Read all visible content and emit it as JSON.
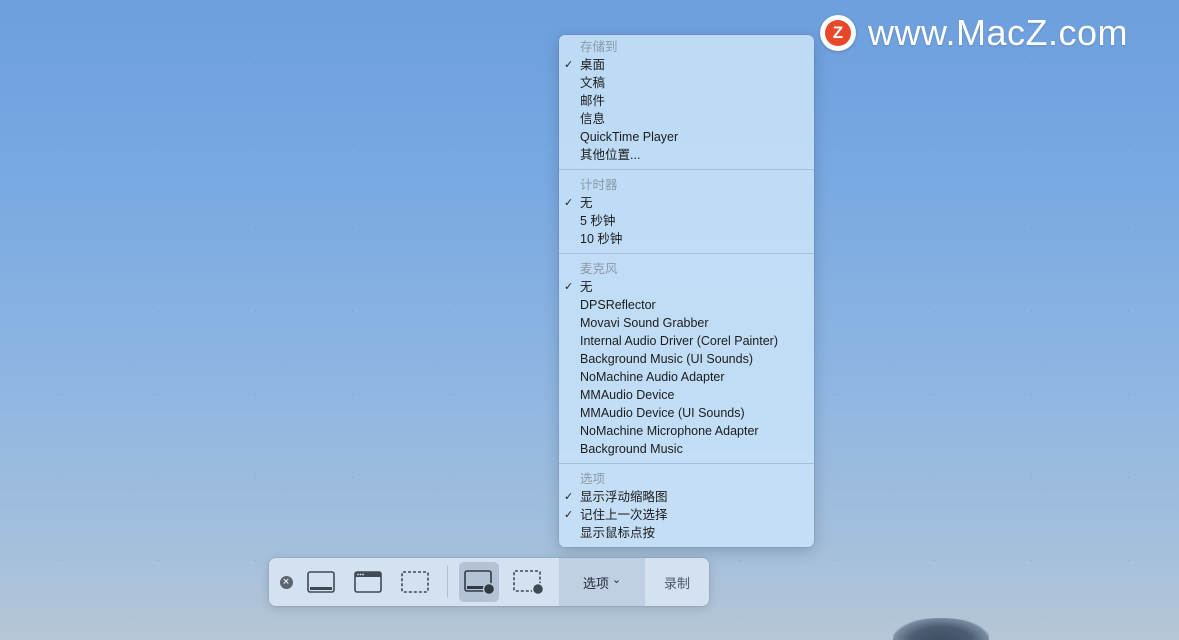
{
  "watermark": {
    "logo_letter": "Z",
    "text": "www.MacZ.com"
  },
  "menu": {
    "sections": [
      {
        "header": "存储到",
        "items": [
          {
            "label": "桌面",
            "checked": true
          },
          {
            "label": "文稿",
            "checked": false
          },
          {
            "label": "邮件",
            "checked": false
          },
          {
            "label": "信息",
            "checked": false
          },
          {
            "label": "QuickTime Player",
            "checked": false
          },
          {
            "label": "其他位置...",
            "checked": false
          }
        ]
      },
      {
        "header": "计时器",
        "items": [
          {
            "label": "无",
            "checked": true
          },
          {
            "label": "5 秒钟",
            "checked": false
          },
          {
            "label": "10 秒钟",
            "checked": false
          }
        ]
      },
      {
        "header": "麦克风",
        "items": [
          {
            "label": "无",
            "checked": true
          },
          {
            "label": "DPSReflector",
            "checked": false
          },
          {
            "label": "Movavi Sound Grabber",
            "checked": false
          },
          {
            "label": "Internal Audio Driver (Corel Painter)",
            "checked": false
          },
          {
            "label": "Background Music (UI Sounds)",
            "checked": false
          },
          {
            "label": "NoMachine Audio Adapter",
            "checked": false
          },
          {
            "label": "MMAudio Device",
            "checked": false
          },
          {
            "label": "MMAudio Device (UI Sounds)",
            "checked": false
          },
          {
            "label": "NoMachine Microphone Adapter",
            "checked": false
          },
          {
            "label": "Background Music",
            "checked": false
          }
        ]
      },
      {
        "header": "选项",
        "items": [
          {
            "label": "显示浮动缩略图",
            "checked": true
          },
          {
            "label": "记住上一次选择",
            "checked": true
          },
          {
            "label": "显示鼠标点按",
            "checked": false
          }
        ]
      }
    ],
    "check_glyph": "✓"
  },
  "toolbar": {
    "close_icon": "close-icon",
    "close_glyph": "×",
    "buttons": [
      {
        "name": "capture-entire-screen-icon"
      },
      {
        "name": "capture-window-icon"
      },
      {
        "name": "capture-selection-icon"
      },
      {
        "name": "record-entire-screen-icon",
        "active": true
      },
      {
        "name": "record-selection-icon"
      }
    ],
    "options_label": "选项",
    "options_chevron": "⌄",
    "record_label": "录制"
  },
  "colors": {
    "menu_bg": "#c8e2f8",
    "header_text": "#8c9aa6",
    "toolbar_bg": "#d7e4f2",
    "watermark_logo": "#e8472a"
  }
}
